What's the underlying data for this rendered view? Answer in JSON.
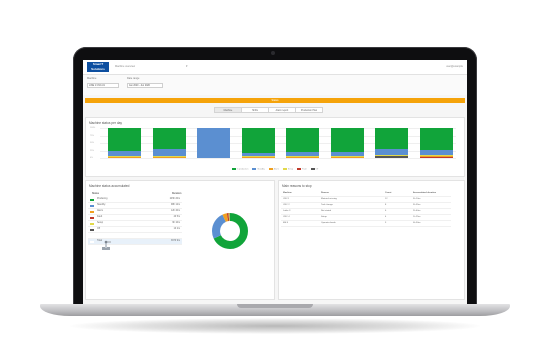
{
  "app": {
    "logo_line1": "SmartT",
    "logo_line2": "Solutions",
    "nav_text": "Machine overview",
    "user_text": "user@example"
  },
  "filters": [
    {
      "label": "Machine",
      "value": "LINE 1 CNC-01"
    },
    {
      "label": "Date range",
      "value": "Jan 2020 - Jun 2020"
    }
  ],
  "banner": "Status",
  "tabs": [
    {
      "label": "Machine",
      "active": true
    },
    {
      "label": "Shifts",
      "active": false
    },
    {
      "label": "Alarm report",
      "active": false
    },
    {
      "label": "Production Plan",
      "active": false
    }
  ],
  "colors": {
    "producing": "#11a43a",
    "standby": "#5b8fd1",
    "alarm": "#f0a020",
    "setup": "#e2d94a",
    "fault": "#c0392b",
    "off": "#555555",
    "banner": "#f5a30a"
  },
  "states_chart": {
    "title": "Machine status per day",
    "y_ticks": [
      "100%",
      "75%",
      "50%",
      "25%",
      "0%"
    ]
  },
  "chart_data": {
    "type": "bar",
    "stacked": true,
    "title": "Machine status per day",
    "categories": [
      "",
      "",
      "",
      "",
      "",
      "",
      "",
      ""
    ],
    "series": [
      {
        "color": "#555555",
        "values": [
          0,
          0,
          0,
          0,
          0,
          0,
          6,
          0
        ]
      },
      {
        "color": "#c0392b",
        "values": [
          0,
          0,
          0,
          0,
          0,
          0,
          0,
          4
        ]
      },
      {
        "color": "#f0a020",
        "values": [
          5,
          5,
          0,
          4,
          5,
          4,
          3,
          5
        ]
      },
      {
        "color": "#e2d94a",
        "values": [
          2,
          2,
          0,
          2,
          2,
          2,
          2,
          2
        ]
      },
      {
        "color": "#5b8fd1",
        "values": [
          16,
          23,
          100,
          12,
          12,
          14,
          19,
          16
        ]
      },
      {
        "color": "#11a43a",
        "values": [
          77,
          70,
          0,
          82,
          81,
          80,
          70,
          73
        ]
      }
    ],
    "ylim": [
      0,
      100
    ],
    "legend_position": "bottom"
  },
  "legend": [
    "In production",
    "Standby",
    "Alarm",
    "Setup",
    "Fault",
    "Off"
  ],
  "status_panel": {
    "title": "Machine status accumulated",
    "header_status": "Status",
    "header_duration": "Duration",
    "rows": [
      {
        "name": "Producing",
        "value": "245h 20m",
        "color": "#11a43a"
      },
      {
        "name": "Standby",
        "value": "98h 12m",
        "color": "#5b8fd1"
      },
      {
        "name": "Alarm",
        "value": "12h 40m",
        "color": "#f0a020"
      },
      {
        "name": "Fault",
        "value": "4h 5m",
        "color": "#c0392b"
      },
      {
        "name": "Setup",
        "value": "6h 10m",
        "color": "#e2d94a"
      },
      {
        "name": "Off",
        "value": "1h 2m",
        "color": "#555555"
      },
      {
        "name": "",
        "value": "",
        "color": "#ffffff"
      },
      {
        "name": "Total",
        "value": "367h 9m",
        "color": "#ffffff"
      }
    ]
  },
  "donut": {
    "values": [
      68,
      25,
      4,
      1.5,
      1,
      0.5
    ],
    "colors": [
      "#11a43a",
      "#5b8fd1",
      "#f0a020",
      "#c0392b",
      "#e2d94a",
      "#555555"
    ]
  },
  "stops_panel": {
    "title": "Main reasons to stop",
    "headers": [
      "Machine",
      "Reason",
      "Count",
      "Accumulated duration"
    ],
    "rows": [
      [
        "CNC1",
        "Material missing",
        "12",
        "5h 10m"
      ],
      [
        "CNC 2",
        "Tool change",
        "8",
        "3h 55m"
      ],
      [
        "Lathe 3",
        "Not stated",
        "6",
        "2h 40m"
      ],
      [
        "CNC 4",
        "Setup",
        "4",
        "1h 25m"
      ],
      [
        "Mill 5",
        "Operator break",
        "3",
        "0h 50m"
      ]
    ]
  }
}
